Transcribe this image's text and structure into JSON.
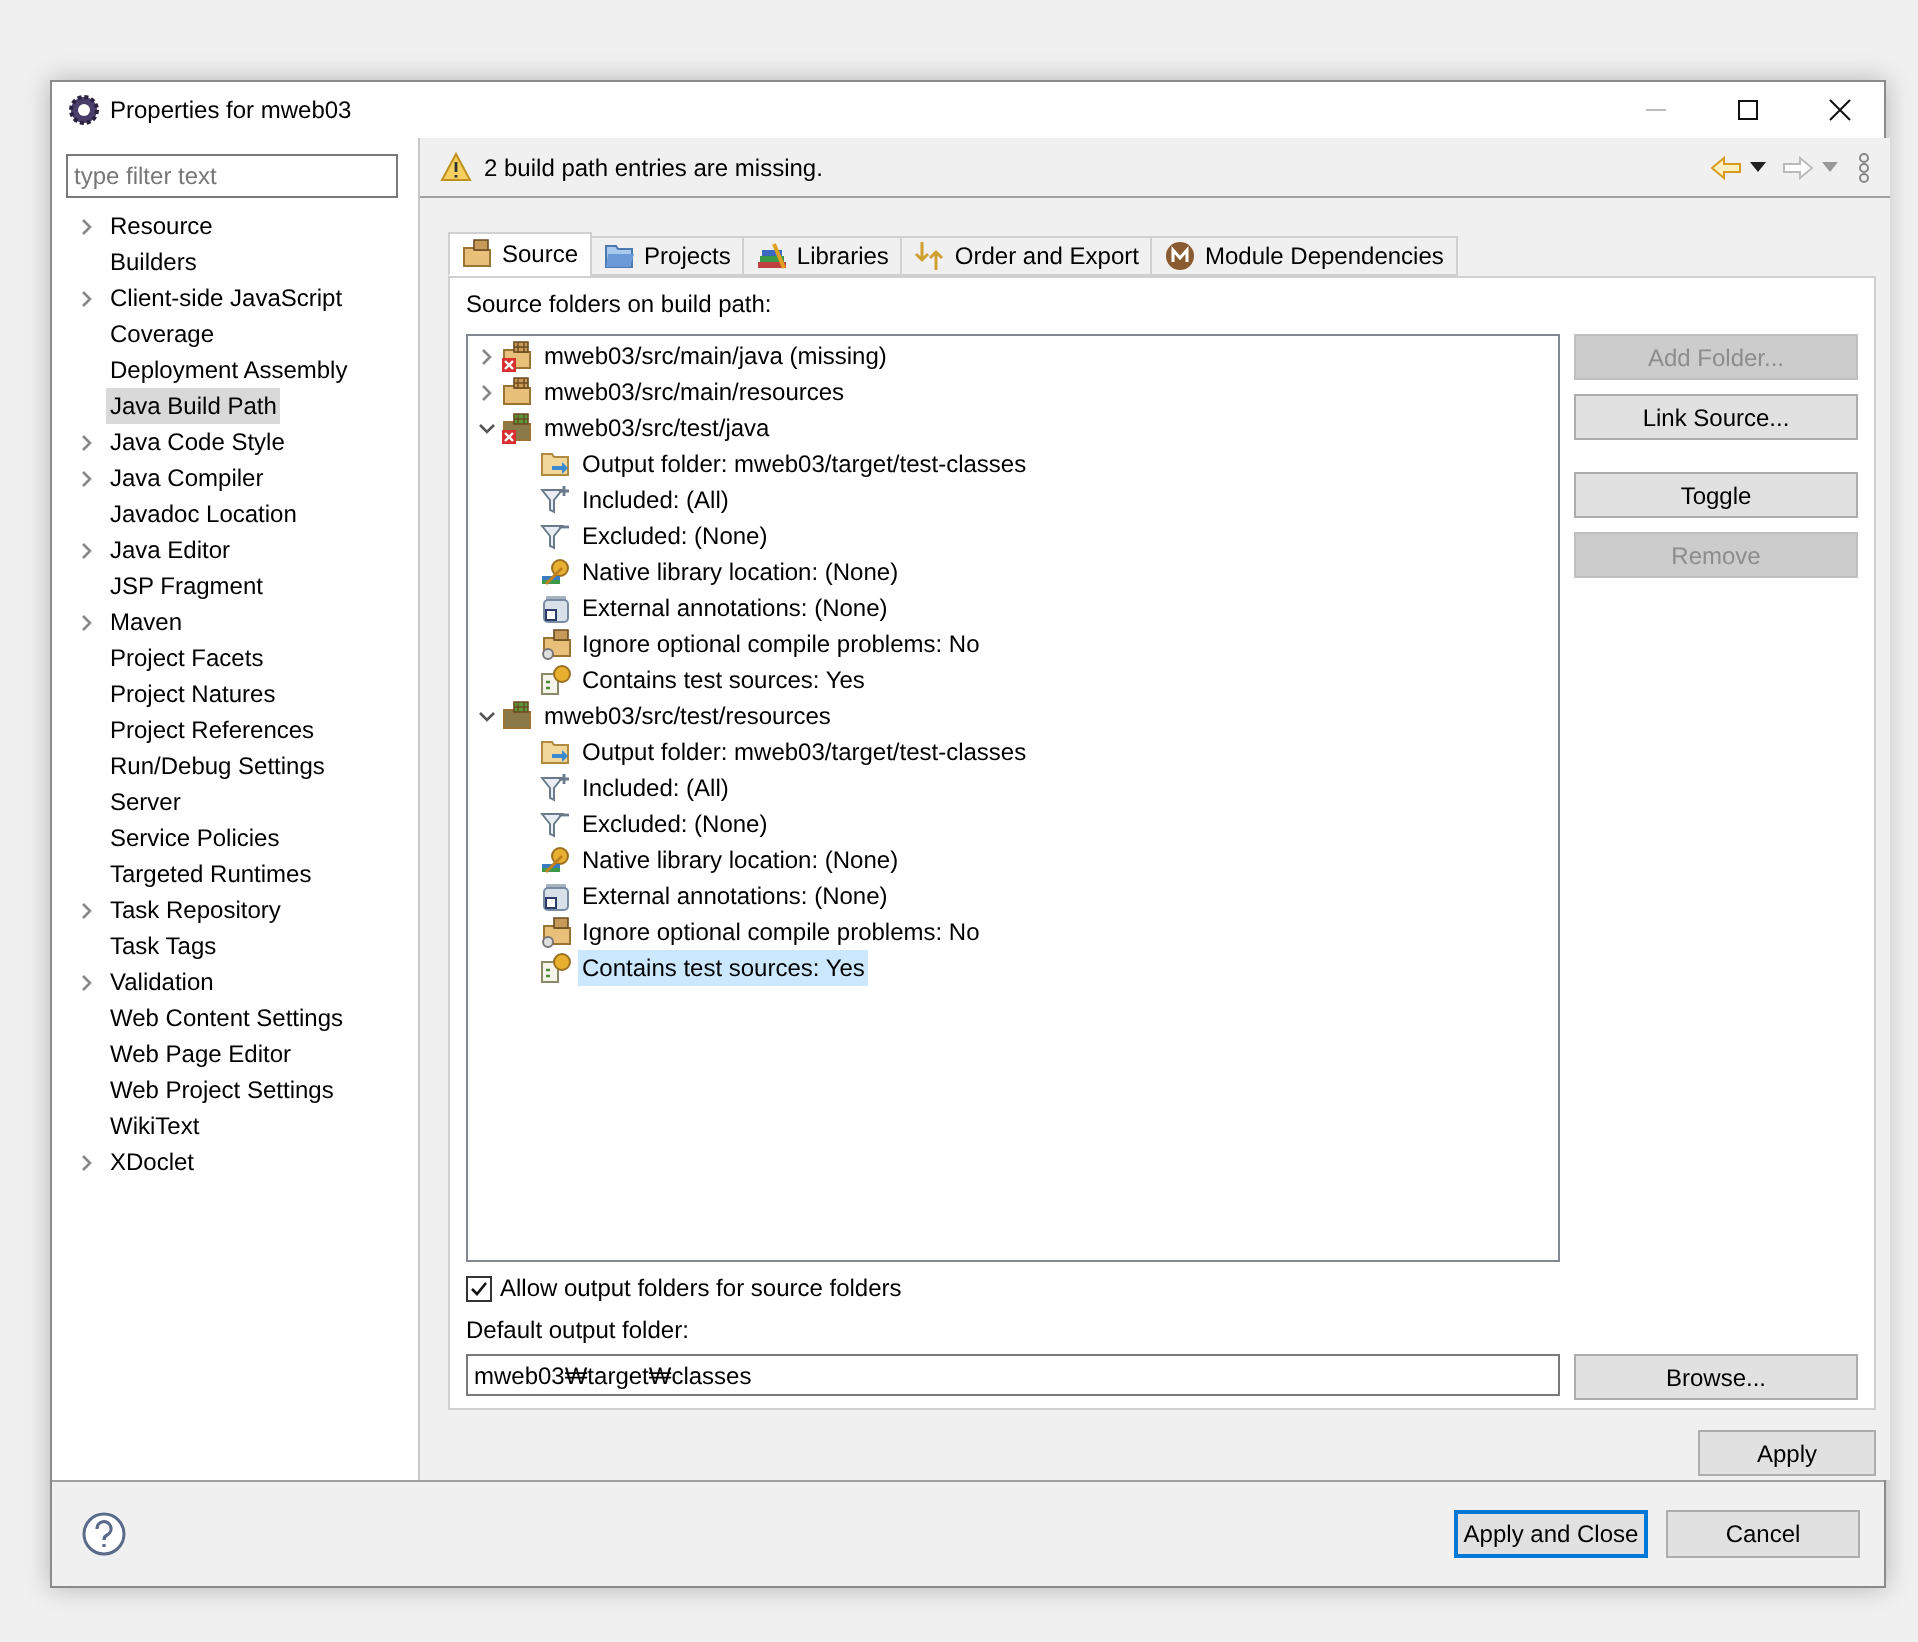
{
  "window": {
    "title": "Properties for mweb03"
  },
  "filter": {
    "placeholder": "type filter text"
  },
  "nav_items": [
    {
      "label": "Resource",
      "expandable": true,
      "selected": false
    },
    {
      "label": "Builders",
      "expandable": false,
      "selected": false
    },
    {
      "label": "Client-side JavaScript",
      "expandable": true,
      "selected": false
    },
    {
      "label": "Coverage",
      "expandable": false,
      "selected": false
    },
    {
      "label": "Deployment Assembly",
      "expandable": false,
      "selected": false
    },
    {
      "label": "Java Build Path",
      "expandable": false,
      "selected": true
    },
    {
      "label": "Java Code Style",
      "expandable": true,
      "selected": false
    },
    {
      "label": "Java Compiler",
      "expandable": true,
      "selected": false
    },
    {
      "label": "Javadoc Location",
      "expandable": false,
      "selected": false
    },
    {
      "label": "Java Editor",
      "expandable": true,
      "selected": false
    },
    {
      "label": "JSP Fragment",
      "expandable": false,
      "selected": false
    },
    {
      "label": "Maven",
      "expandable": true,
      "selected": false
    },
    {
      "label": "Project Facets",
      "expandable": false,
      "selected": false
    },
    {
      "label": "Project Natures",
      "expandable": false,
      "selected": false
    },
    {
      "label": "Project References",
      "expandable": false,
      "selected": false
    },
    {
      "label": "Run/Debug Settings",
      "expandable": false,
      "selected": false
    },
    {
      "label": "Server",
      "expandable": false,
      "selected": false
    },
    {
      "label": "Service Policies",
      "expandable": false,
      "selected": false
    },
    {
      "label": "Targeted Runtimes",
      "expandable": false,
      "selected": false
    },
    {
      "label": "Task Repository",
      "expandable": true,
      "selected": false
    },
    {
      "label": "Task Tags",
      "expandable": false,
      "selected": false
    },
    {
      "label": "Validation",
      "expandable": true,
      "selected": false
    },
    {
      "label": "Web Content Settings",
      "expandable": false,
      "selected": false
    },
    {
      "label": "Web Page Editor",
      "expandable": false,
      "selected": false
    },
    {
      "label": "Web Project Settings",
      "expandable": false,
      "selected": false
    },
    {
      "label": "WikiText",
      "expandable": false,
      "selected": false
    },
    {
      "label": "XDoclet",
      "expandable": true,
      "selected": false
    }
  ],
  "message": "2 build path entries are missing.",
  "tabs": [
    {
      "label": "Source",
      "kind": "source",
      "selected": true
    },
    {
      "label": "Projects",
      "kind": "projects",
      "selected": false
    },
    {
      "label": "Libraries",
      "kind": "libraries",
      "selected": false
    },
    {
      "label": "Order and Export",
      "kind": "order",
      "selected": false
    },
    {
      "label": "Module Dependencies",
      "kind": "module",
      "selected": false
    }
  ],
  "source_label": "Source folders on build path:",
  "source_tree": [
    {
      "label": "mweb03/src/main/java (missing)",
      "error": true,
      "test": false,
      "expanded": false,
      "selected": false
    },
    {
      "label": "mweb03/src/main/resources",
      "error": false,
      "test": false,
      "expanded": false,
      "selected": false
    },
    {
      "label": "mweb03/src/test/java",
      "error": true,
      "test": true,
      "expanded": true,
      "selected": false,
      "children": [
        {
          "label": "Output folder: mweb03/target/test-classes",
          "kind": "output",
          "selected": false
        },
        {
          "label": "Included: (All)",
          "kind": "included",
          "selected": false
        },
        {
          "label": "Excluded: (None)",
          "kind": "excluded",
          "selected": false
        },
        {
          "label": "Native library location: (None)",
          "kind": "native",
          "selected": false
        },
        {
          "label": "External annotations: (None)",
          "kind": "annotations",
          "selected": false
        },
        {
          "label": "Ignore optional compile problems: No",
          "kind": "ignore",
          "selected": false
        },
        {
          "label": "Contains test sources: Yes",
          "kind": "test",
          "selected": false
        }
      ]
    },
    {
      "label": "mweb03/src/test/resources",
      "error": false,
      "test": true,
      "expanded": true,
      "selected": false,
      "children": [
        {
          "label": "Output folder: mweb03/target/test-classes",
          "kind": "output",
          "selected": false
        },
        {
          "label": "Included: (All)",
          "kind": "included",
          "selected": false
        },
        {
          "label": "Excluded: (None)",
          "kind": "excluded",
          "selected": false
        },
        {
          "label": "Native library location: (None)",
          "kind": "native",
          "selected": false
        },
        {
          "label": "External annotations: (None)",
          "kind": "annotations",
          "selected": false
        },
        {
          "label": "Ignore optional compile problems: No",
          "kind": "ignore",
          "selected": false
        },
        {
          "label": "Contains test sources: Yes",
          "kind": "test",
          "selected": true
        }
      ]
    }
  ],
  "side_button_groups": [
    [
      {
        "label": "Add Folder...",
        "disabled": true
      },
      {
        "label": "Link Source...",
        "disabled": false
      }
    ],
    [
      {
        "label": "Toggle",
        "disabled": false
      },
      {
        "label": "Remove",
        "disabled": true
      }
    ]
  ],
  "allow_output": {
    "label": "Allow output folders for source folders",
    "checked": true
  },
  "output_label": "Default output folder:",
  "output_value": "mweb03₩target₩classes",
  "browse_button": "Browse...",
  "apply_button": "Apply",
  "footer_buttons": [
    {
      "label": "Apply and Close",
      "default": true
    },
    {
      "label": "Cancel",
      "default": false
    }
  ]
}
